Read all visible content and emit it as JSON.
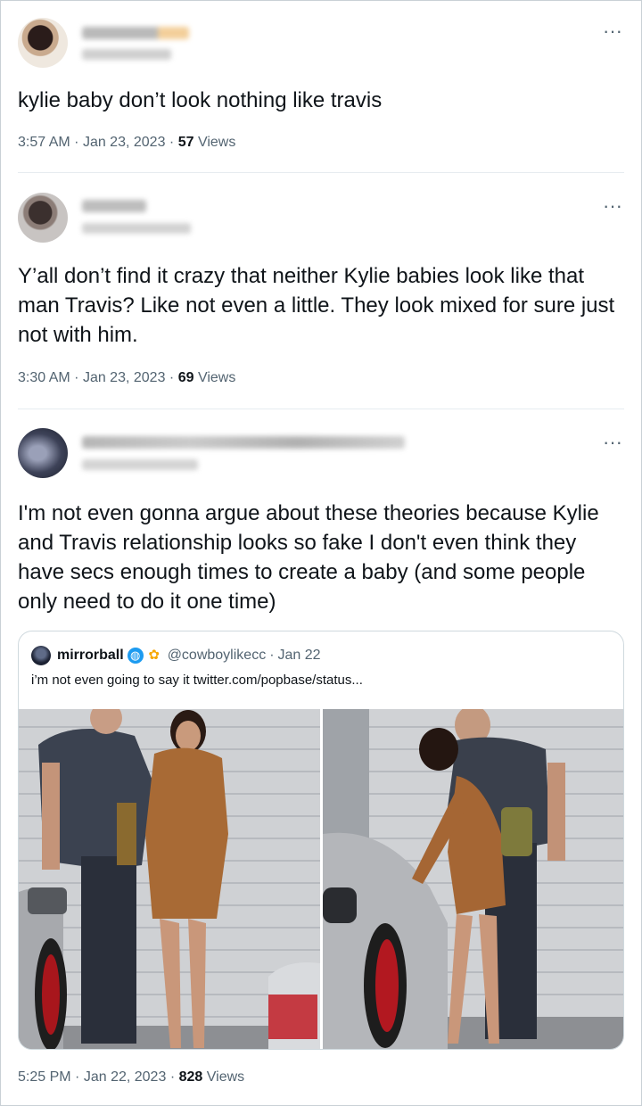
{
  "tweets": [
    {
      "text": "kylie baby don’t look nothing like travis",
      "time": "3:57 AM",
      "date": "Jan 23, 2023",
      "views": "57",
      "views_label": "Views"
    },
    {
      "text": "Y’all don’t find it crazy that neither Kylie babies look like that man Travis? Like not even a little. They look mixed for sure just not with him.",
      "time": "3:30 AM",
      "date": "Jan 23, 2023",
      "views": "69",
      "views_label": "Views"
    },
    {
      "text": "I'm not even gonna argue about these theories because Kylie and Travis relationship looks so fake I don't even think they have secs enough times to create a baby (and some people only need to do it one time)",
      "time": "5:25 PM",
      "date": "Jan 22, 2023",
      "views": "828",
      "views_label": "Views",
      "quote": {
        "name": "mirrorball",
        "handle": "@cowboylikecc",
        "date": "Jan 22",
        "text": "i’m not even going to say it  twitter.com/popbase/status..."
      }
    }
  ],
  "separator": "·",
  "more_glyph": "···",
  "colors": {
    "text_primary": "#0f1419",
    "text_secondary": "#536471",
    "border": "#cfd9de",
    "verified_blue": "#1d9bf0"
  },
  "icons": [
    "more-icon",
    "globe-icon",
    "flower-icon",
    "avatar"
  ]
}
